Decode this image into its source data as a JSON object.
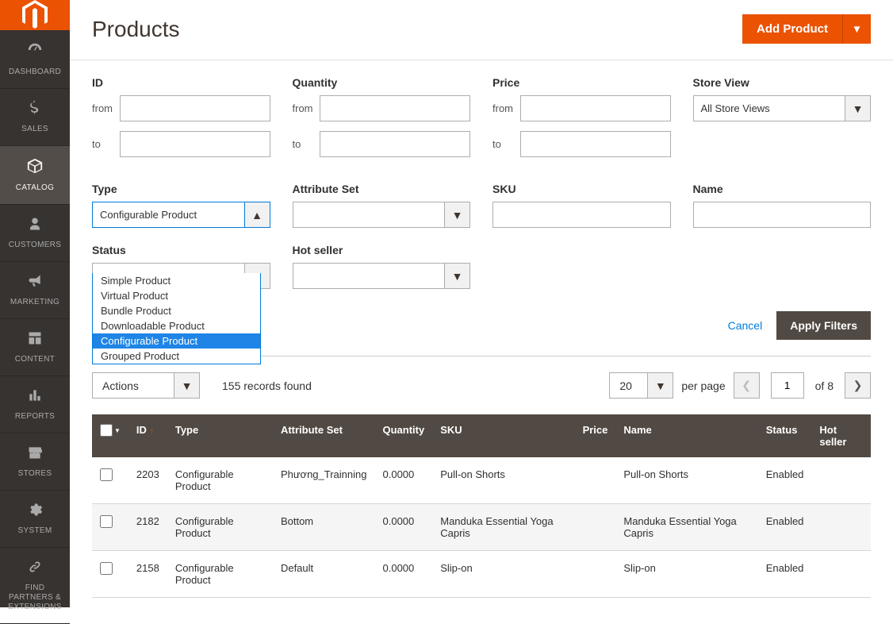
{
  "page": {
    "title": "Products"
  },
  "header": {
    "add_button": "Add Product"
  },
  "sidebar": {
    "items": [
      {
        "label": "DASHBOARD",
        "icon": "dashboard"
      },
      {
        "label": "SALES",
        "icon": "dollar"
      },
      {
        "label": "CATALOG",
        "icon": "box",
        "active": true
      },
      {
        "label": "CUSTOMERS",
        "icon": "person"
      },
      {
        "label": "MARKETING",
        "icon": "megaphone"
      },
      {
        "label": "CONTENT",
        "icon": "layout"
      },
      {
        "label": "REPORTS",
        "icon": "bars"
      },
      {
        "label": "STORES",
        "icon": "storefront"
      },
      {
        "label": "SYSTEM",
        "icon": "gear"
      },
      {
        "label": "FIND PARTNERS & EXTENSIONS",
        "icon": "link"
      }
    ]
  },
  "filters": {
    "id": {
      "label": "ID",
      "from_label": "from",
      "to_label": "to",
      "from": "",
      "to": ""
    },
    "quantity": {
      "label": "Quantity",
      "from_label": "from",
      "to_label": "to",
      "from": "",
      "to": ""
    },
    "price": {
      "label": "Price",
      "from_label": "from",
      "to_label": "to",
      "from": "",
      "to": ""
    },
    "store_view": {
      "label": "Store View",
      "value": "All Store Views"
    },
    "type": {
      "label": "Type",
      "value": "Configurable Product",
      "options": [
        "Simple Product",
        "Virtual Product",
        "Bundle Product",
        "Downloadable Product",
        "Configurable Product",
        "Grouped Product"
      ],
      "selected_index": 4
    },
    "attribute_set": {
      "label": "Attribute Set",
      "value": ""
    },
    "sku": {
      "label": "SKU",
      "value": ""
    },
    "name": {
      "label": "Name",
      "value": ""
    },
    "status": {
      "label": "Status",
      "value": ""
    },
    "hot_seller": {
      "label": "Hot seller",
      "value": ""
    },
    "cancel": "Cancel",
    "apply": "Apply Filters"
  },
  "toolbar": {
    "actions_label": "Actions",
    "records_found": "155 records found",
    "per_page_value": "20",
    "per_page_label": "per page",
    "page_current": "1",
    "page_of_label": "of",
    "page_total": "8"
  },
  "table": {
    "columns": [
      "",
      "ID",
      "Type",
      "Attribute Set",
      "Quantity",
      "SKU",
      "Price",
      "Name",
      "Status",
      "Hot seller"
    ],
    "sort_column": "ID",
    "rows": [
      {
        "id": "2203",
        "type": "Configurable Product",
        "attribute_set": "Phương_Trainning",
        "quantity": "0.0000",
        "sku": "Pull-on Shorts",
        "price": "",
        "name": "Pull-on Shorts",
        "status": "Enabled",
        "hot_seller": ""
      },
      {
        "id": "2182",
        "type": "Configurable Product",
        "attribute_set": "Bottom",
        "quantity": "0.0000",
        "sku": "Manduka Essential Yoga Capris",
        "price": "",
        "name": "Manduka Essential Yoga Capris",
        "status": "Enabled",
        "hot_seller": ""
      },
      {
        "id": "2158",
        "type": "Configurable Product",
        "attribute_set": "Default",
        "quantity": "0.0000",
        "sku": "Slip-on",
        "price": "",
        "name": "Slip-on",
        "status": "Enabled",
        "hot_seller": ""
      }
    ]
  }
}
